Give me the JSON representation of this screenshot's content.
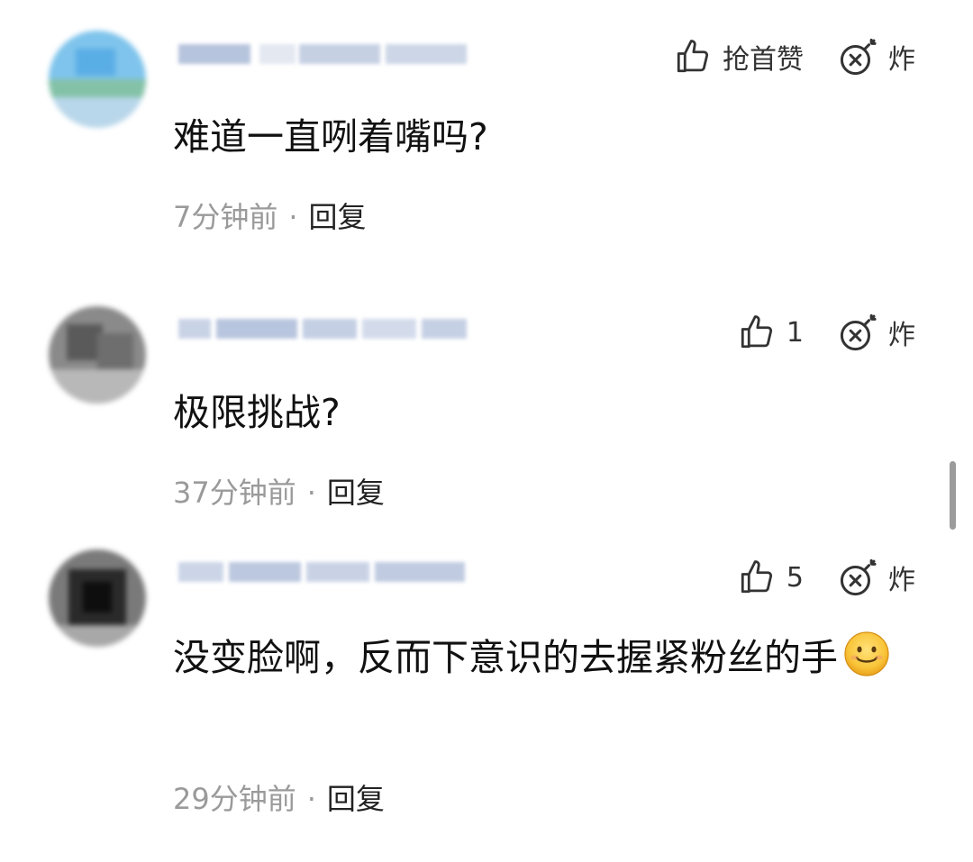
{
  "comments": [
    {
      "like": {
        "label": "抢首赞"
      },
      "bomb_label": "炸",
      "text": "难道一直咧着嘴吗?",
      "time": "7分钟前",
      "dot": "·",
      "reply": "回复"
    },
    {
      "like": {
        "label": "1"
      },
      "bomb_label": "炸",
      "text": "极限挑战?",
      "time": "37分钟前",
      "dot": "·",
      "reply": "回复"
    },
    {
      "like": {
        "label": "5"
      },
      "bomb_label": "炸",
      "text": "没变脸啊，反而下意识的去握紧粉丝的手",
      "emoji": "smiling-face",
      "time": "29分钟前",
      "dot": "·",
      "reply": "回复"
    }
  ],
  "icons": {
    "like": "thumbs-up-icon",
    "bomb": "bomb-icon"
  },
  "colors": {
    "text": "#111111",
    "meta": "#9a9a9a",
    "icon": "#333333",
    "scrollbar": "#9b9b9b"
  }
}
